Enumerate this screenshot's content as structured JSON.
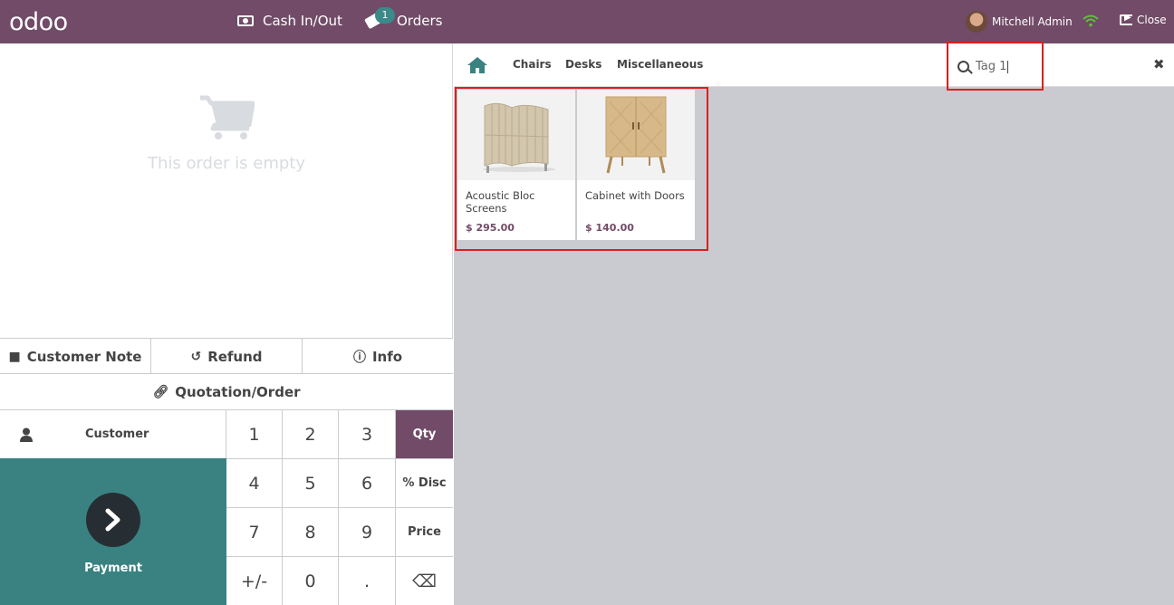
{
  "header": {
    "logo": "odoo",
    "cash_label": "Cash In/Out",
    "orders_label": "Orders",
    "orders_count": "1",
    "user_name": "Mitchell Admin",
    "close_label": "Close"
  },
  "order": {
    "empty_text": "This order is empty"
  },
  "controls": {
    "customer_note": "Customer Note",
    "refund": "Refund",
    "info": "Info",
    "quotation": "Quotation/Order",
    "customer": "Customer",
    "payment": "Payment"
  },
  "numpad": {
    "k1": "1",
    "k2": "2",
    "k3": "3",
    "qty": "Qty",
    "k4": "4",
    "k5": "5",
    "k6": "6",
    "disc": "% Disc",
    "k7": "7",
    "k8": "8",
    "k9": "9",
    "price": "Price",
    "sign": "+/-",
    "k0": "0",
    "dot": ".",
    "backspace": "⌫"
  },
  "categories": [
    "Chairs",
    "Desks",
    "Miscellaneous"
  ],
  "search": {
    "value": "Tag 1"
  },
  "products": [
    {
      "name": "Acoustic Bloc Screens",
      "price": "$ 295.00"
    },
    {
      "name": "Cabinet with Doors",
      "price": "$ 140.00"
    }
  ],
  "colors": {
    "brand": "#714b67",
    "payment": "#3a8282",
    "highlight": "#e01d1d"
  }
}
